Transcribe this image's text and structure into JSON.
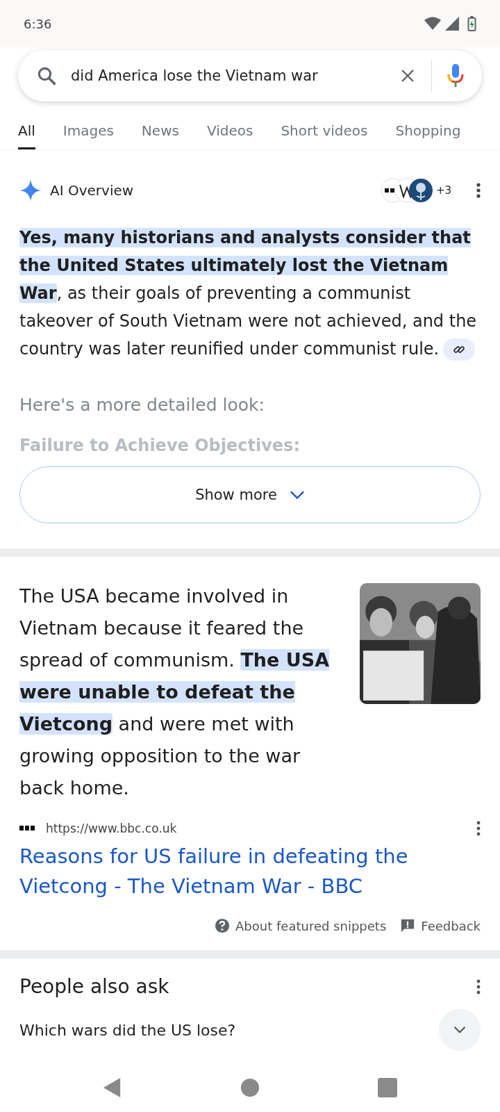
{
  "status_bar": {
    "time": "6:36"
  },
  "search": {
    "value": "did America lose the Vietnam war"
  },
  "tabs": [
    {
      "label": "All",
      "selected": true
    },
    {
      "label": "Images",
      "selected": false
    },
    {
      "label": "News",
      "selected": false
    },
    {
      "label": "Videos",
      "selected": false
    },
    {
      "label": "Short videos",
      "selected": false
    },
    {
      "label": "Shopping",
      "selected": false
    }
  ],
  "ai_overview": {
    "title": "AI Overview",
    "sources_more": "+3",
    "summary": "**Yes, many historians and analysts consider that the United States ultimately lost the Vietnam War**, as their goals of preventing a communist takeover of South Vietnam were not achieved, and the country was later reunified under communist rule.",
    "detail_heading": "Here's a more detailed look:",
    "faded_heading": "Failure to Achieve Objectives:",
    "show_more": "Show more"
  },
  "featured_snippet": {
    "text": "The USA became involved in Vietnam because it feared the spread of communism. **The USA were unable to defeat the Vietcong** and were met with growing opposition to the war back home.",
    "url": "https://www.bbc.co.uk",
    "title": "Reasons for US failure in defeating the Vietcong - The Vietnam War - BBC",
    "about": "About featured snippets",
    "feedback": "Feedback"
  },
  "people_also_ask": {
    "title": "People also ask",
    "questions": [
      "Which wars did the US lose?"
    ]
  }
}
